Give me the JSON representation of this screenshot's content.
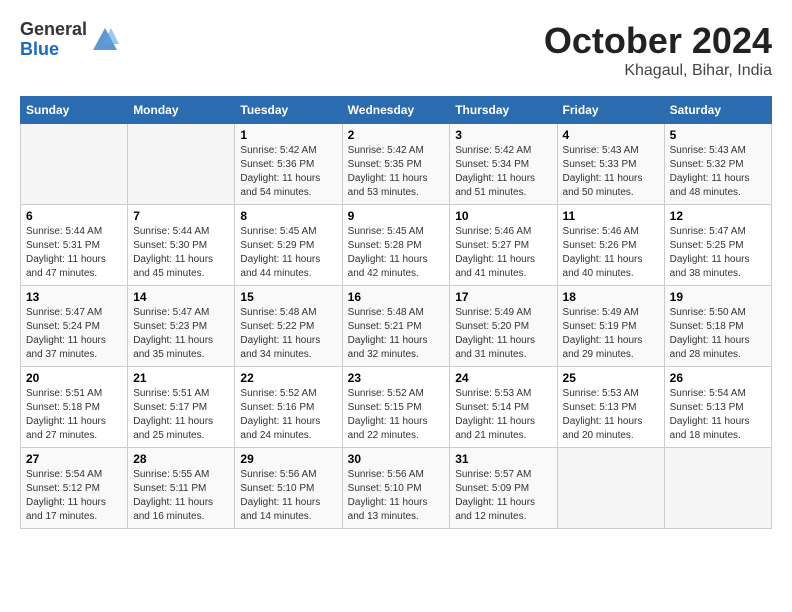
{
  "header": {
    "logo_general": "General",
    "logo_blue": "Blue",
    "month_title": "October 2024",
    "location": "Khagaul, Bihar, India"
  },
  "weekdays": [
    "Sunday",
    "Monday",
    "Tuesday",
    "Wednesday",
    "Thursday",
    "Friday",
    "Saturday"
  ],
  "weeks": [
    [
      {
        "day": "",
        "text": ""
      },
      {
        "day": "",
        "text": ""
      },
      {
        "day": "1",
        "text": "Sunrise: 5:42 AM\nSunset: 5:36 PM\nDaylight: 11 hours\nand 54 minutes."
      },
      {
        "day": "2",
        "text": "Sunrise: 5:42 AM\nSunset: 5:35 PM\nDaylight: 11 hours\nand 53 minutes."
      },
      {
        "day": "3",
        "text": "Sunrise: 5:42 AM\nSunset: 5:34 PM\nDaylight: 11 hours\nand 51 minutes."
      },
      {
        "day": "4",
        "text": "Sunrise: 5:43 AM\nSunset: 5:33 PM\nDaylight: 11 hours\nand 50 minutes."
      },
      {
        "day": "5",
        "text": "Sunrise: 5:43 AM\nSunset: 5:32 PM\nDaylight: 11 hours\nand 48 minutes."
      }
    ],
    [
      {
        "day": "6",
        "text": "Sunrise: 5:44 AM\nSunset: 5:31 PM\nDaylight: 11 hours\nand 47 minutes."
      },
      {
        "day": "7",
        "text": "Sunrise: 5:44 AM\nSunset: 5:30 PM\nDaylight: 11 hours\nand 45 minutes."
      },
      {
        "day": "8",
        "text": "Sunrise: 5:45 AM\nSunset: 5:29 PM\nDaylight: 11 hours\nand 44 minutes."
      },
      {
        "day": "9",
        "text": "Sunrise: 5:45 AM\nSunset: 5:28 PM\nDaylight: 11 hours\nand 42 minutes."
      },
      {
        "day": "10",
        "text": "Sunrise: 5:46 AM\nSunset: 5:27 PM\nDaylight: 11 hours\nand 41 minutes."
      },
      {
        "day": "11",
        "text": "Sunrise: 5:46 AM\nSunset: 5:26 PM\nDaylight: 11 hours\nand 40 minutes."
      },
      {
        "day": "12",
        "text": "Sunrise: 5:47 AM\nSunset: 5:25 PM\nDaylight: 11 hours\nand 38 minutes."
      }
    ],
    [
      {
        "day": "13",
        "text": "Sunrise: 5:47 AM\nSunset: 5:24 PM\nDaylight: 11 hours\nand 37 minutes."
      },
      {
        "day": "14",
        "text": "Sunrise: 5:47 AM\nSunset: 5:23 PM\nDaylight: 11 hours\nand 35 minutes."
      },
      {
        "day": "15",
        "text": "Sunrise: 5:48 AM\nSunset: 5:22 PM\nDaylight: 11 hours\nand 34 minutes."
      },
      {
        "day": "16",
        "text": "Sunrise: 5:48 AM\nSunset: 5:21 PM\nDaylight: 11 hours\nand 32 minutes."
      },
      {
        "day": "17",
        "text": "Sunrise: 5:49 AM\nSunset: 5:20 PM\nDaylight: 11 hours\nand 31 minutes."
      },
      {
        "day": "18",
        "text": "Sunrise: 5:49 AM\nSunset: 5:19 PM\nDaylight: 11 hours\nand 29 minutes."
      },
      {
        "day": "19",
        "text": "Sunrise: 5:50 AM\nSunset: 5:18 PM\nDaylight: 11 hours\nand 28 minutes."
      }
    ],
    [
      {
        "day": "20",
        "text": "Sunrise: 5:51 AM\nSunset: 5:18 PM\nDaylight: 11 hours\nand 27 minutes."
      },
      {
        "day": "21",
        "text": "Sunrise: 5:51 AM\nSunset: 5:17 PM\nDaylight: 11 hours\nand 25 minutes."
      },
      {
        "day": "22",
        "text": "Sunrise: 5:52 AM\nSunset: 5:16 PM\nDaylight: 11 hours\nand 24 minutes."
      },
      {
        "day": "23",
        "text": "Sunrise: 5:52 AM\nSunset: 5:15 PM\nDaylight: 11 hours\nand 22 minutes."
      },
      {
        "day": "24",
        "text": "Sunrise: 5:53 AM\nSunset: 5:14 PM\nDaylight: 11 hours\nand 21 minutes."
      },
      {
        "day": "25",
        "text": "Sunrise: 5:53 AM\nSunset: 5:13 PM\nDaylight: 11 hours\nand 20 minutes."
      },
      {
        "day": "26",
        "text": "Sunrise: 5:54 AM\nSunset: 5:13 PM\nDaylight: 11 hours\nand 18 minutes."
      }
    ],
    [
      {
        "day": "27",
        "text": "Sunrise: 5:54 AM\nSunset: 5:12 PM\nDaylight: 11 hours\nand 17 minutes."
      },
      {
        "day": "28",
        "text": "Sunrise: 5:55 AM\nSunset: 5:11 PM\nDaylight: 11 hours\nand 16 minutes."
      },
      {
        "day": "29",
        "text": "Sunrise: 5:56 AM\nSunset: 5:10 PM\nDaylight: 11 hours\nand 14 minutes."
      },
      {
        "day": "30",
        "text": "Sunrise: 5:56 AM\nSunset: 5:10 PM\nDaylight: 11 hours\nand 13 minutes."
      },
      {
        "day": "31",
        "text": "Sunrise: 5:57 AM\nSunset: 5:09 PM\nDaylight: 11 hours\nand 12 minutes."
      },
      {
        "day": "",
        "text": ""
      },
      {
        "day": "",
        "text": ""
      }
    ]
  ]
}
